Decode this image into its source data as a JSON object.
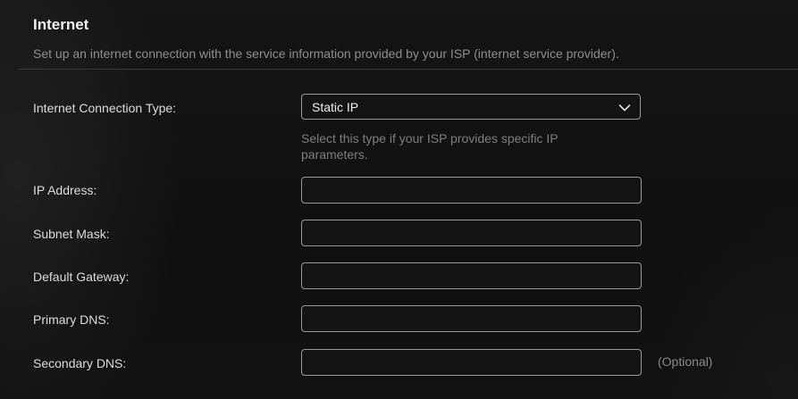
{
  "section": {
    "title": "Internet",
    "description": "Set up an internet connection with the service information provided by your ISP (internet service provider)."
  },
  "connection_type": {
    "label": "Internet Connection Type:",
    "selected": "Static IP",
    "icon": "chevron-down-icon",
    "hint": "Select this type if your ISP provides specific IP parameters."
  },
  "fields": {
    "ip_address": {
      "label": "IP Address:",
      "value": "",
      "placeholder": ""
    },
    "subnet_mask": {
      "label": "Subnet Mask:",
      "value": "",
      "placeholder": ""
    },
    "default_gateway": {
      "label": "Default Gateway:",
      "value": "",
      "placeholder": ""
    },
    "primary_dns": {
      "label": "Primary DNS:",
      "value": "",
      "placeholder": ""
    },
    "secondary_dns": {
      "label": "Secondary DNS:",
      "value": "",
      "placeholder": "",
      "note": "(Optional)"
    }
  },
  "colors": {
    "background": "#111111",
    "border": "#9a9a9a",
    "label_text": "#dcdcdc",
    "muted_text": "#8e8e8e"
  }
}
